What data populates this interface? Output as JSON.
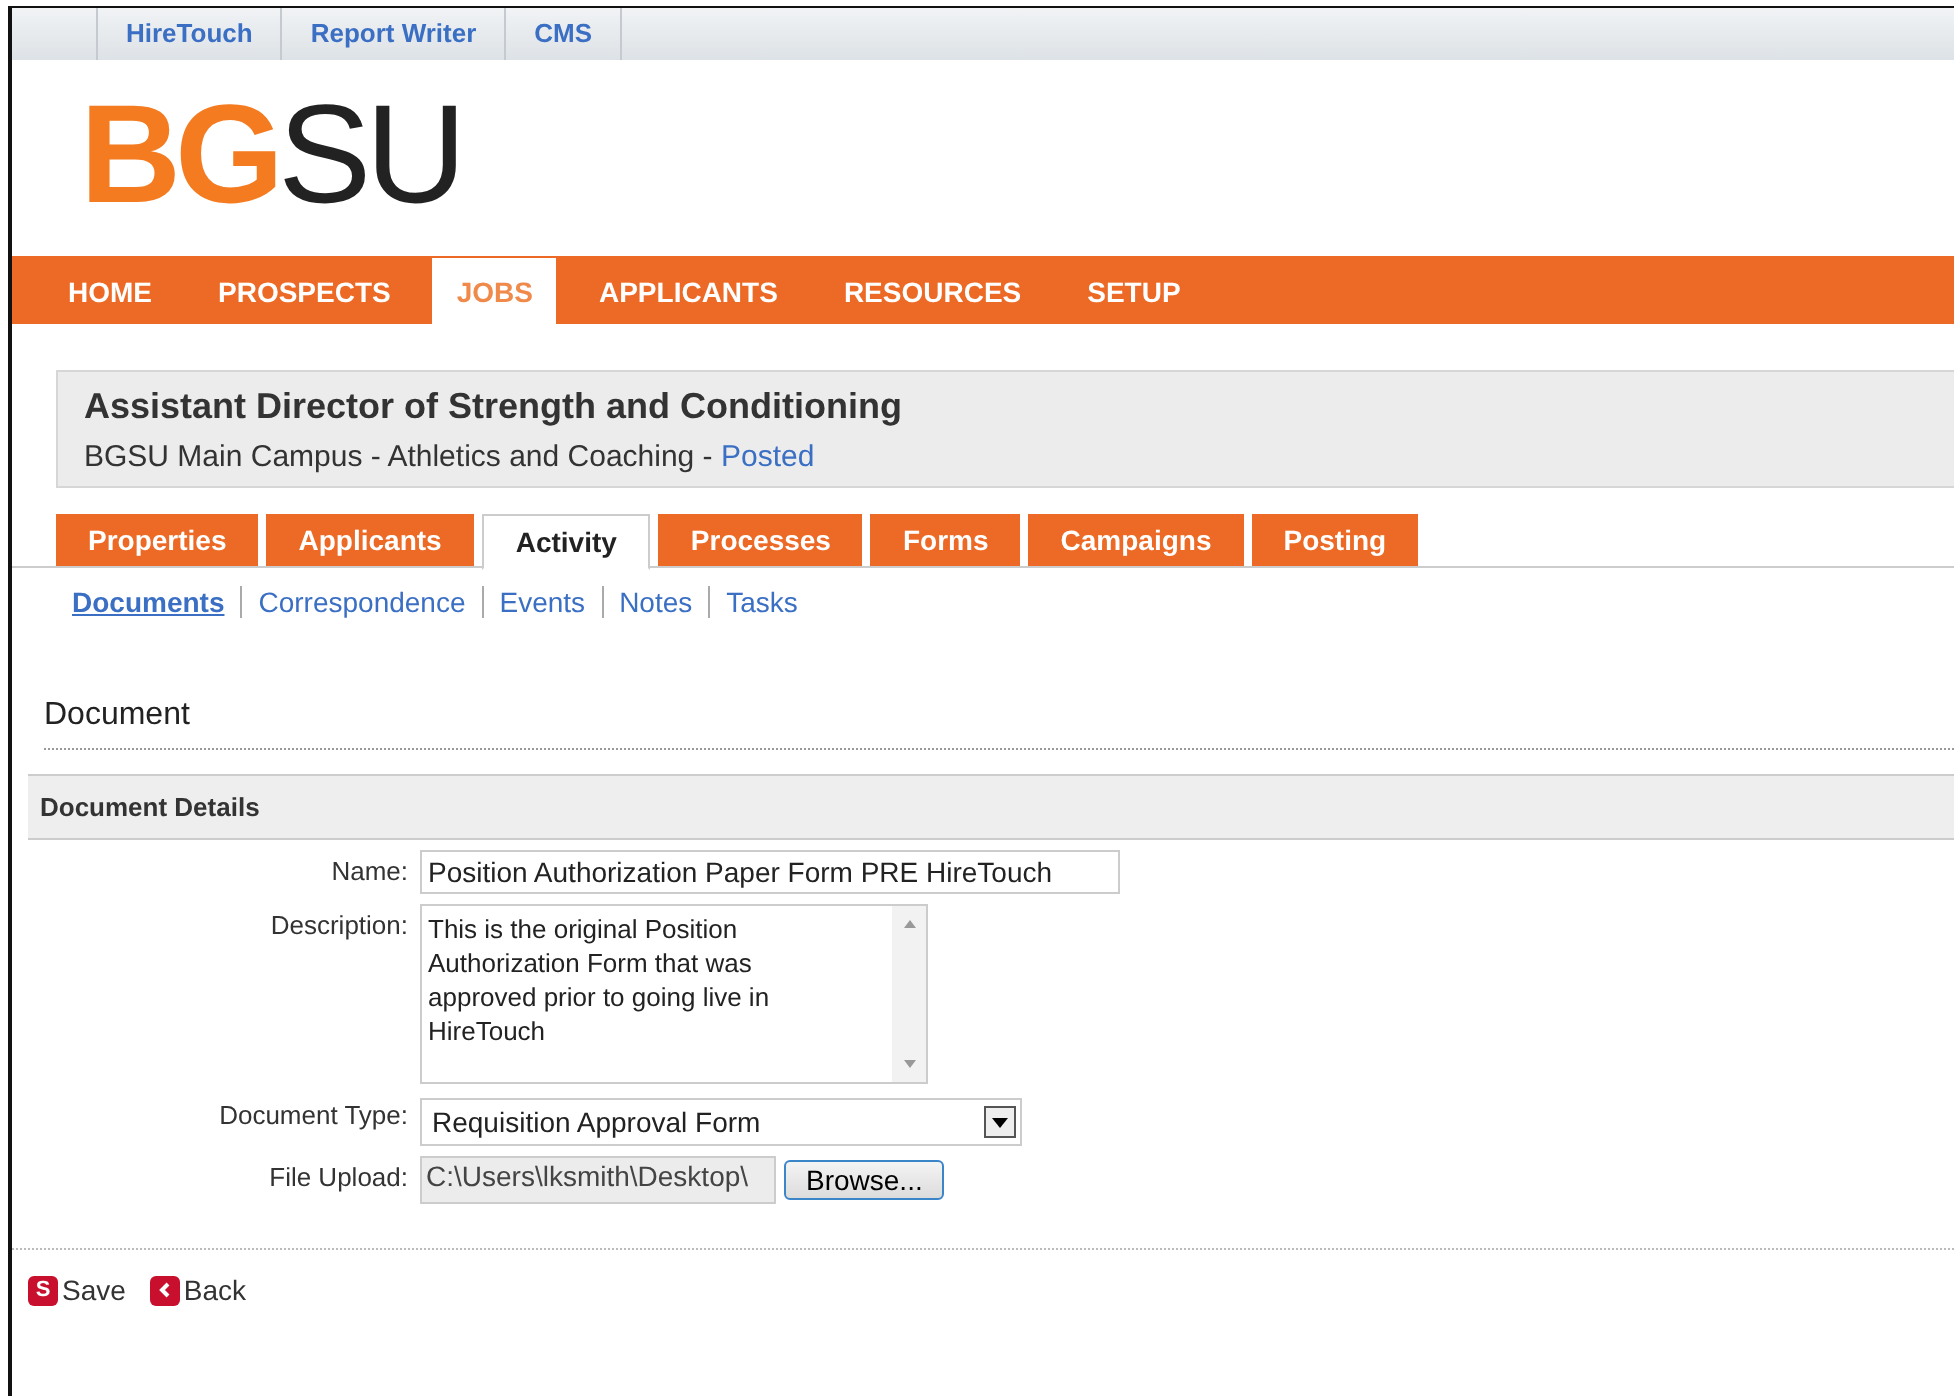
{
  "top_links": [
    {
      "label": "HireTouch"
    },
    {
      "label": "Report Writer"
    },
    {
      "label": "CMS"
    }
  ],
  "logo": {
    "part_1": "BG",
    "part_2": "SU"
  },
  "main_nav": [
    {
      "label": "HOME",
      "selected": false
    },
    {
      "label": "PROSPECTS",
      "selected": false
    },
    {
      "label": "JOBS",
      "selected": true
    },
    {
      "label": "APPLICANTS",
      "selected": false
    },
    {
      "label": "RESOURCES",
      "selected": false
    },
    {
      "label": "SETUP",
      "selected": false
    }
  ],
  "job": {
    "title": "Assistant Director of Strength and Conditioning",
    "subtitle": "BGSU Main Campus - Athletics and Coaching - ",
    "status": "Posted"
  },
  "tabs": [
    {
      "label": "Properties",
      "selected": false
    },
    {
      "label": "Applicants",
      "selected": false
    },
    {
      "label": "Activity",
      "selected": true
    },
    {
      "label": "Processes",
      "selected": false
    },
    {
      "label": "Forms",
      "selected": false
    },
    {
      "label": "Campaigns",
      "selected": false
    },
    {
      "label": "Posting",
      "selected": false
    }
  ],
  "sub_nav": [
    {
      "label": "Documents",
      "selected": true
    },
    {
      "label": "Correspondence",
      "selected": false
    },
    {
      "label": "Events",
      "selected": false
    },
    {
      "label": "Notes",
      "selected": false
    },
    {
      "label": "Tasks",
      "selected": false
    }
  ],
  "page_heading": "Document",
  "section": {
    "title": "Document Details"
  },
  "form": {
    "name_label": "Name:",
    "name_value": "Position Authorization Paper Form PRE HireTouch",
    "description_label": "Description:",
    "description_value": "This is the original Position Authorization Form that was approved prior to going live in HireTouch",
    "type_label": "Document Type:",
    "type_value": "Requisition Approval Form",
    "upload_label": "File Upload:",
    "upload_value": "C:\\Users\\lksmith\\Desktop\\",
    "browse_button": "Browse..."
  },
  "actions": {
    "save_icon": "S",
    "save": "Save",
    "back": "Back"
  }
}
